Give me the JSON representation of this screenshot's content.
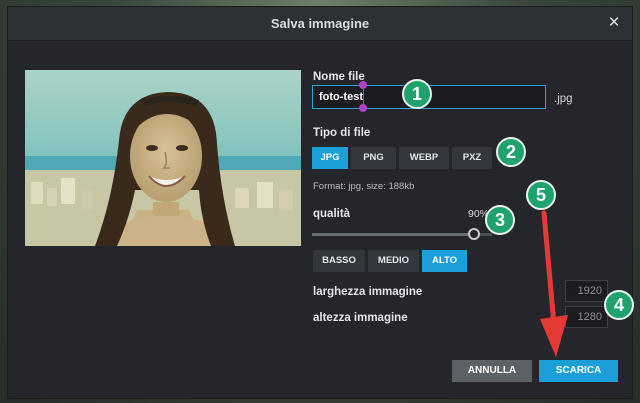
{
  "dialog": {
    "title": "Salva immagine",
    "close_glyph": "×"
  },
  "file_name": {
    "label": "Nome file",
    "value": "foto-test",
    "extension": ".jpg"
  },
  "file_type": {
    "label": "Tipo di file",
    "options": [
      "JPG",
      "PNG",
      "WEBP",
      "PXZ"
    ],
    "selected": "JPG",
    "info": "Format: jpg, size: 188kb"
  },
  "quality": {
    "label": "qualità",
    "value_text": "90%",
    "value_fraction": 0.9,
    "presets": [
      "BASSO",
      "MEDIO",
      "ALTO"
    ],
    "selected_preset": "ALTO"
  },
  "dimensions": {
    "width_label": "larghezza immagine",
    "width_value": "1920",
    "height_label": "altezza immagine",
    "height_value": "1280"
  },
  "actions": {
    "cancel_label": "ANNULLA",
    "download_label": "SCARICA"
  },
  "annotations": {
    "badges": [
      "1",
      "2",
      "3",
      "4",
      "5"
    ],
    "badge_color": "#20a26c",
    "arrow_color": "#e53935"
  },
  "colors": {
    "accent": "#1c9fd9",
    "dialog_bg": "#24262b",
    "selection_handle": "#b340c8"
  }
}
